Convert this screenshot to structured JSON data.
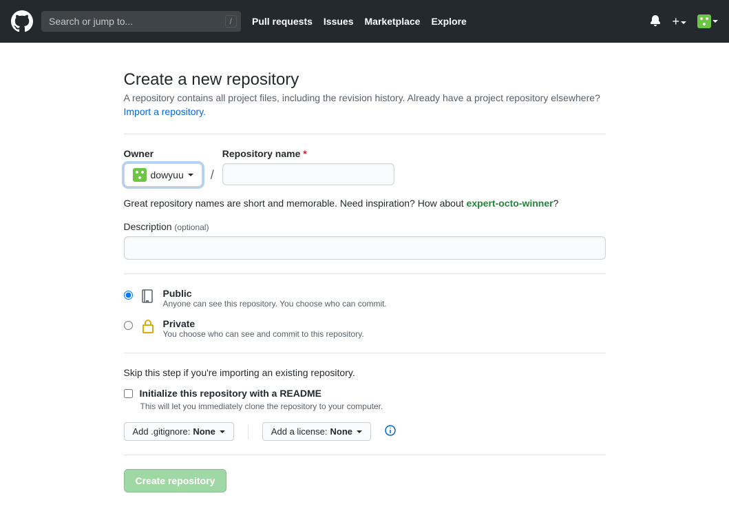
{
  "header": {
    "search_placeholder": "Search or jump to...",
    "slash_hint": "/",
    "nav": {
      "pull_requests": "Pull requests",
      "issues": "Issues",
      "marketplace": "Marketplace",
      "explore": "Explore"
    }
  },
  "page": {
    "title": "Create a new repository",
    "lead": "A repository contains all project files, including the revision history. Already have a project repository elsewhere?",
    "import_link": "Import a repository."
  },
  "form": {
    "owner_label": "Owner",
    "owner_value": "dowyuu",
    "repo_name_label": "Repository name",
    "repo_name_value": "",
    "slash": "/",
    "name_tip_prefix": "Great repository names are short and memorable. Need inspiration? How about ",
    "name_tip_suggestion": "expert-octo-winner",
    "name_tip_suffix": "?",
    "description_label": "Description",
    "optional_text": "(optional)",
    "description_value": "",
    "visibility": {
      "public_label": "Public",
      "public_desc": "Anyone can see this repository. You choose who can commit.",
      "private_label": "Private",
      "private_desc": "You choose who can see and commit to this repository.",
      "selected": "public"
    },
    "skip_text": "Skip this step if you're importing an existing repository.",
    "readme_label": "Initialize this repository with a README",
    "readme_desc": "This will let you immediately clone the repository to your computer.",
    "readme_checked": false,
    "gitignore_btn_prefix": "Add .gitignore: ",
    "gitignore_value": "None",
    "license_btn_prefix": "Add a license: ",
    "license_value": "None",
    "submit_label": "Create repository"
  }
}
